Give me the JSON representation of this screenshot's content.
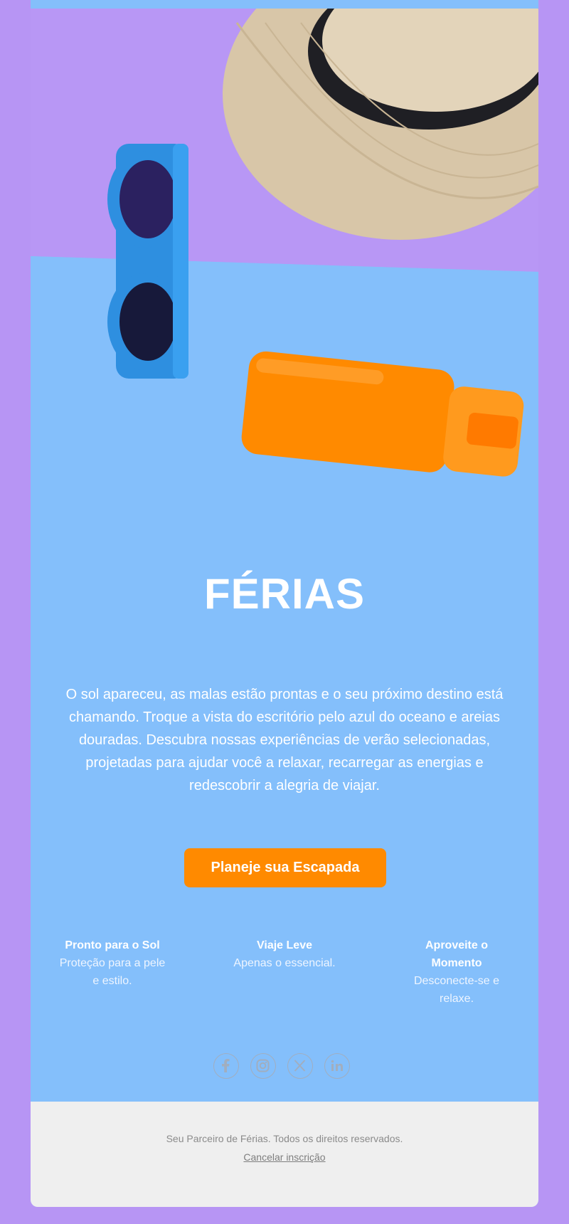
{
  "colors": {
    "page_background": "#b795f4",
    "card_background": "#84bffb",
    "button": "#ff8a00",
    "footer_background": "#efefef"
  },
  "hero": {
    "image": "summer-vacation-flatlay",
    "objects": [
      "straw-hat",
      "blue-sunglasses",
      "orange-sunscreen-bottle"
    ]
  },
  "title": "FÉRIAS",
  "body_lines": [
    "O sol apareceu, as malas estão prontas e o seu próximo destino está",
    "chamando. Troque a vista do escritório pelo azul do oceano e areias",
    "douradas. Descubra nossas experiências de verão selecionadas,",
    "projetadas para ajudar você a relaxar, recarregar as energias e",
    "redescobrir a alegria de viajar."
  ],
  "cta_label": "Planeje sua Escapada",
  "features": [
    {
      "title": "Pronto para o Sol",
      "desc_lines": [
        "Proteção para a pele",
        "e estilo."
      ]
    },
    {
      "title": "Viaje Leve",
      "desc_lines": [
        "Apenas o essencial."
      ]
    },
    {
      "title_lines": [
        "Aproveite o",
        "Momento"
      ],
      "desc_lines": [
        "Desconecte-se e",
        "relaxe."
      ]
    }
  ],
  "social_icons": [
    "facebook-icon",
    "instagram-icon",
    "x-icon",
    "linkedin-icon"
  ],
  "footer": {
    "rights": "Seu Parceiro de Férias. Todos os direitos reservados.",
    "unsubscribe": "Cancelar inscrição"
  }
}
